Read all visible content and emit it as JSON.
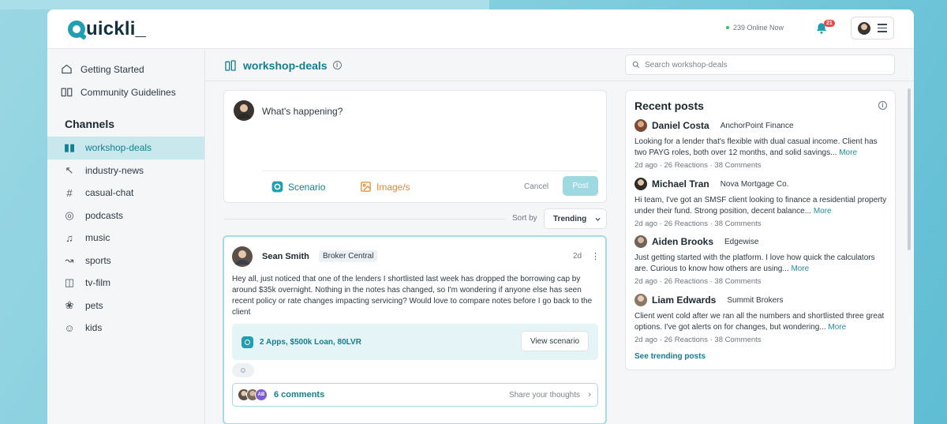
{
  "header": {
    "logo": "Quickli_",
    "online_text": "239 Online Now",
    "notification_count": "21"
  },
  "sidebar": {
    "links": [
      {
        "label": "Getting Started",
        "icon": "home-icon"
      },
      {
        "label": "Community Guidelines",
        "icon": "book-icon"
      }
    ],
    "channels_title": "Channels",
    "channels": [
      {
        "label": "workshop-deals",
        "icon": "workshop-icon",
        "active": true
      },
      {
        "label": "industry-news",
        "icon": "cursor-icon"
      },
      {
        "label": "casual-chat",
        "icon": "hash-icon"
      },
      {
        "label": "podcasts",
        "icon": "podcast-icon"
      },
      {
        "label": "music",
        "icon": "music-note-icon"
      },
      {
        "label": "sports",
        "icon": "sports-icon"
      },
      {
        "label": "tv-film",
        "icon": "clapperboard-icon"
      },
      {
        "label": "pets",
        "icon": "paw-icon"
      },
      {
        "label": "kids",
        "icon": "smiley-icon"
      }
    ]
  },
  "channel_header": {
    "title": "workshop-deals",
    "search_placeholder": "Search workshop-deals"
  },
  "composer": {
    "placeholder": "What's happening?",
    "scenario_label": "Scenario",
    "image_label": "Image/s",
    "cancel_label": "Cancel",
    "post_label": "Post"
  },
  "sort": {
    "label": "Sort by",
    "value": "Trending"
  },
  "post": {
    "author": "Sean Smith",
    "org": "Broker Central",
    "time": "2d",
    "body": "Hey all, just noticed that one of the lenders I shortlisted last week has dropped the borrowing cap by around $35k overnight. Nothing in the notes has changed, so I'm wondering if anyone else has seen recent policy or rate changes impacting servicing? Would love to compare notes before I go back to the client",
    "scenario_text": "2 Apps, $500k Loan, 80LVR",
    "view_scenario_label": "View scenario",
    "comments_label": "6 comments",
    "avatar_initials": "AB",
    "share_placeholder": "Share your thoughts"
  },
  "recent": {
    "title": "Recent posts",
    "more_label": "More",
    "items": [
      {
        "name": "Daniel Costa",
        "company": "AnchorPoint Finance",
        "text": "Looking for a lender that's flexible with dual casual income. Client has two PAYG roles, both over 12 months, and solid savings...",
        "time": "2d ago",
        "reactions": "26 Reactions",
        "comments": "38 Comments"
      },
      {
        "name": "Michael Tran",
        "company": "Nova Mortgage Co.",
        "text": "Hi team, I've got an SMSF client looking to finance a residential property under their fund. Strong position, decent balance...",
        "time": "2d ago",
        "reactions": "26 Reactions",
        "comments": "38 Comments"
      },
      {
        "name": "Aiden Brooks",
        "company": "Edgewise",
        "text": "Just getting started with the platform. I love how quick the calculators are. Curious to know how others are using...",
        "time": "2d ago",
        "reactions": "26 Reactions",
        "comments": "38 Comments"
      },
      {
        "name": "Liam Edwards",
        "company": "Summit Brokers",
        "text": "Client went cold after we ran all the numbers and shortlisted three great options. I've got alerts on for changes, but wondering...",
        "time": "2d ago",
        "reactions": "26 Reactions",
        "comments": "38 Comments"
      }
    ],
    "see_trending": "See trending posts"
  },
  "colors": {
    "accent": "#157e8e",
    "active_bg": "#c8e8ee",
    "image_accent": "#e38934",
    "online_dot": "#3bbf5a",
    "badge": "#e24a4a"
  }
}
